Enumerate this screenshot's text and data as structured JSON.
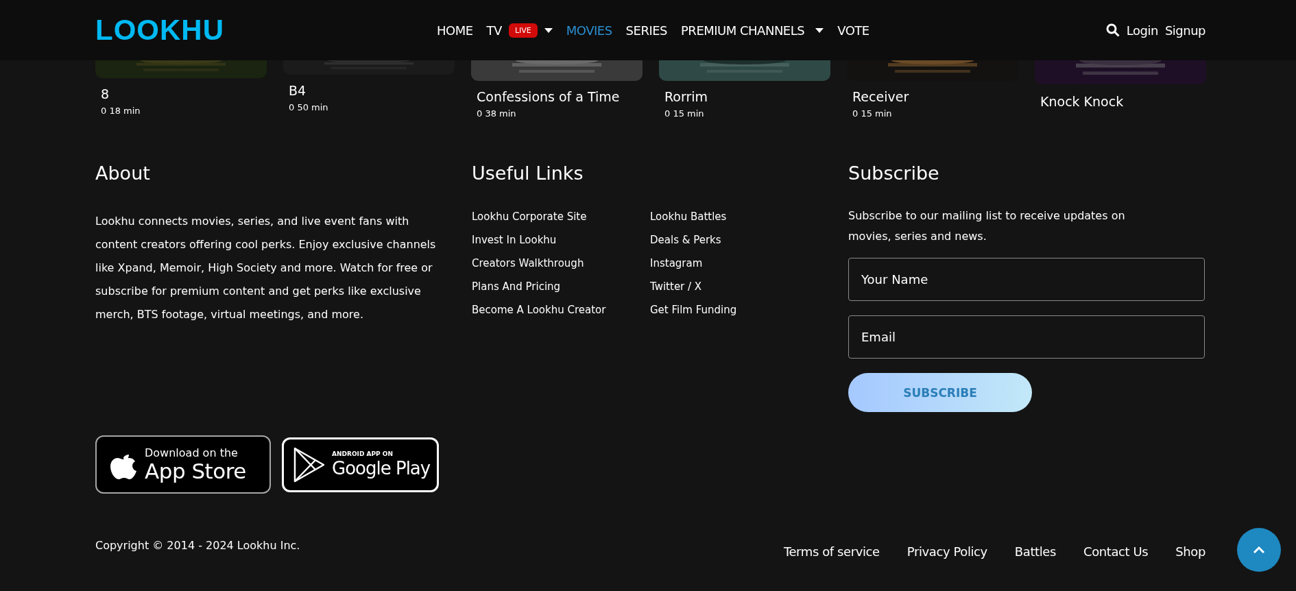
{
  "header": {
    "logo": "LOOKHU",
    "nav": [
      {
        "label": "HOME",
        "selected": false
      },
      {
        "label": "TV",
        "selected": false,
        "badge": "LIVE",
        "dropdown": true
      },
      {
        "label": "MOVIES",
        "selected": true
      },
      {
        "label": "SERIES",
        "selected": false
      },
      {
        "label": "PREMIUM CHANNELS",
        "selected": false,
        "dropdown": true
      },
      {
        "label": "VOTE",
        "selected": false
      }
    ],
    "login": "Login",
    "signup": "Signup"
  },
  "movies": [
    {
      "title": "8",
      "duration": "0 18 min"
    },
    {
      "title": "B4",
      "duration": "0 50 min"
    },
    {
      "title": "Confessions of a Time",
      "duration": "0 38 min"
    },
    {
      "title": "Rorrim",
      "duration": "0 15 min"
    },
    {
      "title": "Receiver",
      "duration": "0 15 min"
    },
    {
      "title": "Knock Knock"
    }
  ],
  "about": {
    "heading": "About",
    "text": "Lookhu connects movies, series, and live event fans with content creators offering cool perks. Enjoy exclusive channels like Xpand, Memoir, High Society and more. Watch for free or subscribe for premium content and get perks like exclusive merch, BTS footage, virtual meetings, and more."
  },
  "useful_links": {
    "heading": "Useful Links",
    "columns": [
      [
        "Lookhu Corporate Site",
        "Invest In Lookhu",
        "Creators Walkthrough",
        "Plans And Pricing",
        "Become A Lookhu Creator"
      ],
      [
        "Lookhu Battles",
        "Deals & Perks",
        "Instagram",
        "Twitter / X",
        "Get Film Funding"
      ]
    ]
  },
  "subscribe": {
    "heading": "Subscribe",
    "text": "Subscribe to our mailing list to receive updates on movies, series and news.",
    "name_placeholder": "Your Name",
    "email_placeholder": "Email",
    "button": "SUBSCRIBE"
  },
  "app_badges": {
    "app_store": {
      "small": "Download on the",
      "large": "App Store"
    },
    "google_play": {
      "small": "ANDROID APP ON",
      "large": "Google Play"
    }
  },
  "copyright": "Copyright © 2014 - 2024 Lookhu Inc.",
  "footer_links": [
    "Terms of service",
    "Privacy Policy",
    "Battles",
    "Contact Us",
    "Shop"
  ]
}
